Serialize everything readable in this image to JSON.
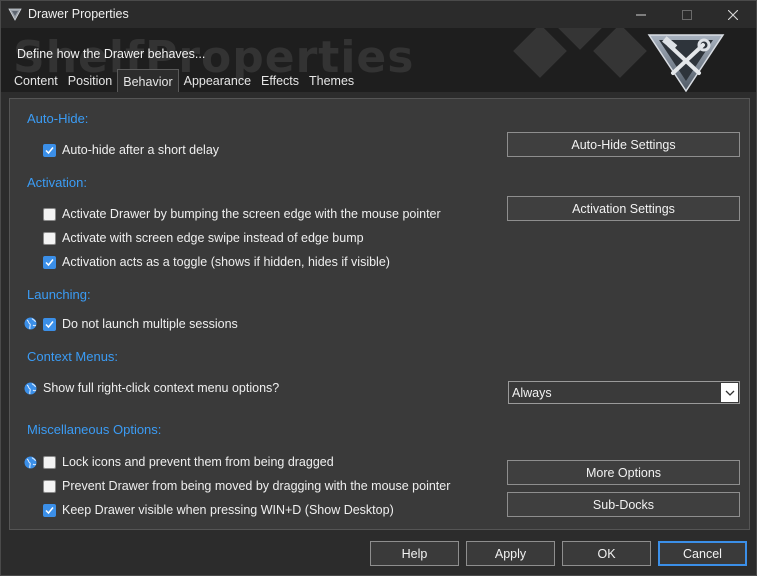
{
  "window": {
    "title": "Drawer Properties",
    "controls": {
      "minimize": "—",
      "maximize": "☐",
      "close": "✕"
    }
  },
  "header": {
    "description": "Define how the Drawer behaves...",
    "watermark": "ShelfProperties"
  },
  "tabs": [
    {
      "label": "Content"
    },
    {
      "label": "Position"
    },
    {
      "label": "Behavior",
      "active": true
    },
    {
      "label": "Appearance"
    },
    {
      "label": "Effects"
    },
    {
      "label": "Themes"
    }
  ],
  "sections": {
    "autohide": {
      "heading": "Auto-Hide:",
      "options": [
        {
          "label": "Auto-hide after a short delay",
          "checked": true
        }
      ],
      "button": "Auto-Hide Settings"
    },
    "activation": {
      "heading": "Activation:",
      "options": [
        {
          "label": "Activate Drawer by bumping the screen edge with the mouse pointer",
          "checked": false
        },
        {
          "label": "Activate with screen edge swipe instead of edge bump",
          "checked": false
        },
        {
          "label": "Activation acts as a toggle (shows if hidden, hides if visible)",
          "checked": true
        }
      ],
      "button": "Activation Settings"
    },
    "launching": {
      "heading": "Launching:",
      "options": [
        {
          "label": "Do not launch multiple sessions",
          "checked": true,
          "global": true
        }
      ]
    },
    "context": {
      "heading": "Context Menus:",
      "label": "Show full right-click context menu options?",
      "select_value": "Always"
    },
    "misc": {
      "heading": "Miscellaneous Options:",
      "options": [
        {
          "label": "Lock icons and prevent them from being dragged",
          "checked": false,
          "global": true
        },
        {
          "label": "Prevent Drawer from being moved by dragging with the mouse pointer",
          "checked": false
        },
        {
          "label": "Keep Drawer visible when pressing WIN+D (Show Desktop)",
          "checked": true
        }
      ],
      "buttons": [
        "More Options",
        "Sub-Docks"
      ]
    }
  },
  "footer": {
    "help": "Help",
    "apply": "Apply",
    "ok": "OK",
    "cancel": "Cancel"
  },
  "colors": {
    "accent": "#3b9cf5",
    "checkbox_on": "#3b8fe8",
    "panel": "#3a3a3a",
    "window": "#2c2c2c"
  }
}
